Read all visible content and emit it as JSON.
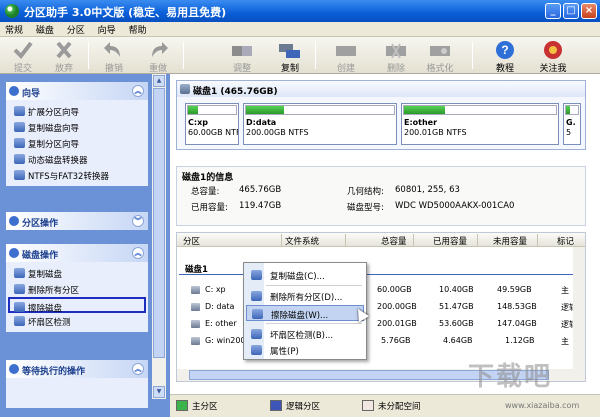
{
  "window": {
    "title": "分区助手 3.0中文版 (稳定、易用且免费)",
    "controls": [
      "_",
      "□",
      "×"
    ]
  },
  "menu": [
    "常规",
    "磁盘",
    "分区",
    "向导",
    "帮助"
  ],
  "toolbar": [
    {
      "label": "提交",
      "icon": "check-icon",
      "enabled": false
    },
    {
      "label": "放弃",
      "icon": "discard-icon",
      "enabled": false
    },
    {
      "label": "撤销",
      "icon": "undo-icon",
      "enabled": false
    },
    {
      "label": "重做",
      "icon": "redo-icon",
      "enabled": false
    },
    {
      "label": "调整",
      "icon": "resize-icon",
      "enabled": false
    },
    {
      "label": "复制",
      "icon": "copy-disk-icon",
      "enabled": true
    },
    {
      "label": "创建",
      "icon": "create-icon",
      "enabled": false
    },
    {
      "label": "删除",
      "icon": "delete-icon",
      "enabled": false
    },
    {
      "label": "格式化",
      "icon": "format-icon",
      "enabled": false
    },
    {
      "label": "教程",
      "icon": "help-icon",
      "enabled": true
    },
    {
      "label": "关注我",
      "icon": "follow-icon",
      "enabled": true
    }
  ],
  "sidebar": {
    "wizard": {
      "title": "向导",
      "items": [
        "扩展分区向导",
        "复制磁盘向导",
        "复制分区向导",
        "动态磁盘转换器",
        "NTFS与FAT32转换器"
      ]
    },
    "partition_ops": {
      "title": "分区操作"
    },
    "disk_ops": {
      "title": "磁盘操作",
      "items": [
        "复制磁盘",
        "删除所有分区",
        "擦除磁盘",
        "坏扇区检测"
      ]
    },
    "pending": {
      "title": "等待执行的操作"
    }
  },
  "disk": {
    "title": "磁盘1 (465.76GB)",
    "partitions": [
      {
        "name": "C:xp",
        "detail": "60.00GB NTFS",
        "used": 0.2
      },
      {
        "name": "D:data",
        "detail": "200.00GB NTFS",
        "used": 0.26
      },
      {
        "name": "E:other",
        "detail": "200.01GB NTFS",
        "used": 0.27
      },
      {
        "name": "G.",
        "detail": "5",
        "used": 0.3
      }
    ]
  },
  "info": {
    "title": "磁盘1的信息",
    "total_label": "总容量:",
    "total": "465.76GB",
    "used_label": "已用容量:",
    "used": "119.47GB",
    "geometry_label": "几何结构:",
    "geometry": "60801, 255, 63",
    "model_label": "磁盘型号:",
    "model": "WDC WD5000AAKX-001CA0"
  },
  "table": {
    "headers": [
      "分区",
      "文件系统",
      "总容量",
      "已用容量",
      "未用容量",
      "标记"
    ],
    "group": "磁盘1",
    "rows": [
      {
        "name": "C: xp",
        "total": "60.00GB",
        "used": "10.40GB",
        "free": "49.59GB",
        "flag": "主"
      },
      {
        "name": "D: data",
        "total": "200.00GB",
        "used": "51.47GB",
        "free": "148.53GB",
        "flag": "逻辑"
      },
      {
        "name": "E: other",
        "total": "200.01GB",
        "used": "53.60GB",
        "free": "147.04GB",
        "flag": "逻辑"
      },
      {
        "name": "G: win200",
        "total": "5.76GB",
        "used": "4.64GB",
        "free": "1.12GB",
        "flag": "主"
      }
    ]
  },
  "context_menu": [
    "复制磁盘(C)...",
    "删除所有分区(D)...",
    "擦除磁盘(W)...",
    "坏扇区检测(B)...",
    "属性(P)"
  ],
  "legend": [
    {
      "label": "主分区",
      "color": "#3cb44a"
    },
    {
      "label": "逻辑分区",
      "color": "#3d55b8"
    },
    {
      "label": "未分配空间",
      "color": "#f2e6e0"
    }
  ],
  "watermark": {
    "big": "下载吧",
    "small": "www.xiazaiba.com"
  }
}
